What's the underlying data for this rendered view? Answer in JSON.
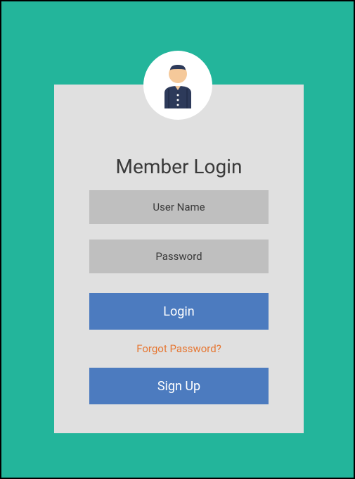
{
  "form": {
    "title": "Member Login",
    "username_placeholder": "User Name",
    "password_placeholder": "Password",
    "login_label": "Login",
    "forgot_label": "Forgot Password?",
    "signup_label": "Sign Up"
  }
}
